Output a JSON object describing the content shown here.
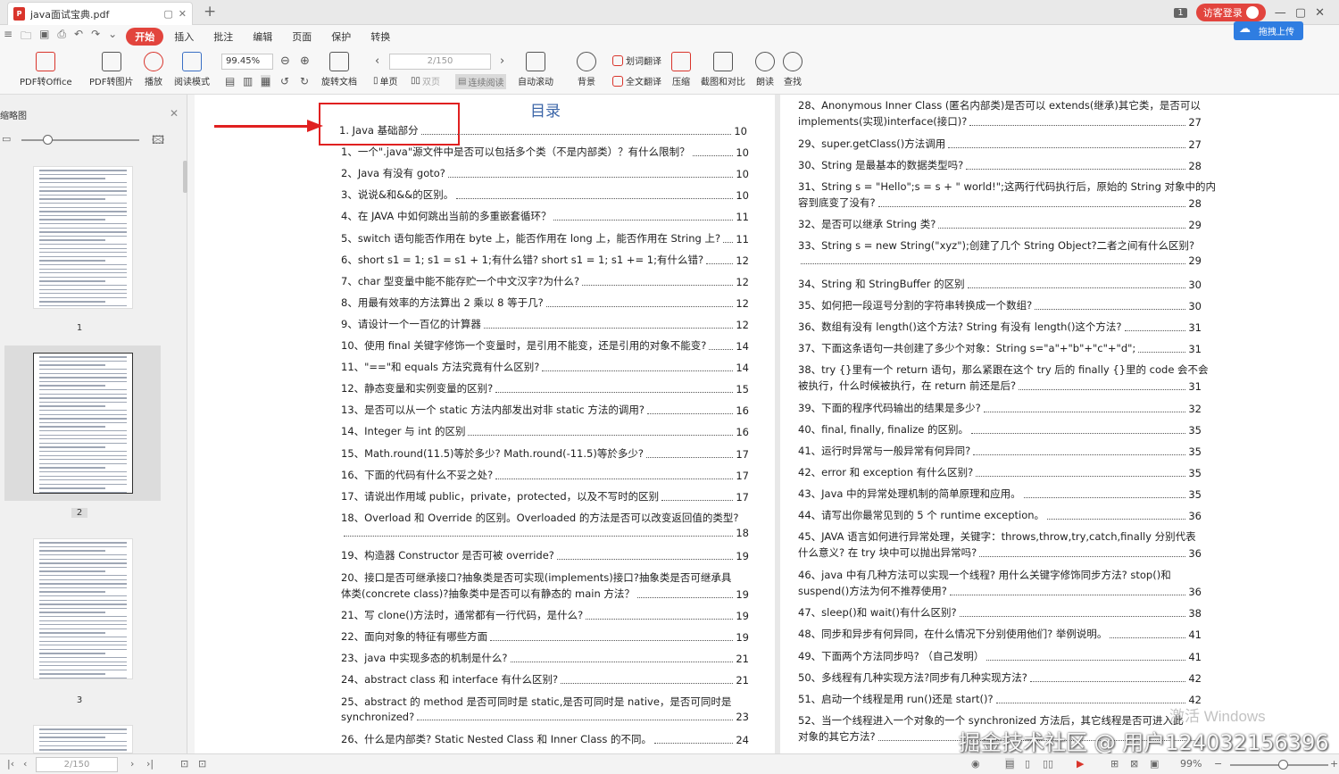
{
  "tab": {
    "title": "java面试宝典.pdf"
  },
  "header": {
    "page_badge": "1",
    "login_label": "访客登录",
    "upload_label": "拖拽上传"
  },
  "menu": [
    "开始",
    "插入",
    "批注",
    "编辑",
    "页面",
    "保护",
    "转换"
  ],
  "toolbar": {
    "pdf_to_office": "PDF转Office",
    "pdf_to_image": "PDF转图片",
    "play": "播放",
    "read_mode": "阅读模式",
    "zoom": "99.45%",
    "rotate": "旋转文档",
    "page_value": "2/150",
    "single": "单页",
    "double": "双页",
    "continuous": "连续阅读",
    "autoscroll": "自动滚动",
    "background": "背景",
    "word_translate": "划词翻译",
    "full_translate": "全文翻译",
    "compress": "压缩",
    "screenshot_compare": "截图和对比",
    "read_aloud": "朗读",
    "find": "查找"
  },
  "sidebar": {
    "title": "缩略图",
    "thumb_labels": [
      "1",
      "2",
      "3"
    ]
  },
  "toc": {
    "title": "目录",
    "left": [
      {
        "text": "1. Java 基础部分",
        "page": "10"
      },
      {
        "text": "1、一个\".java\"源文件中是否可以包括多个类（不是内部类）？有什么限制？",
        "page": "10"
      },
      {
        "text": "2、Java 有没有 goto?",
        "page": "10"
      },
      {
        "text": "3、说说&和&&的区别。",
        "page": "10"
      },
      {
        "text": "4、在 JAVA 中如何跳出当前的多重嵌套循环？",
        "page": "11"
      },
      {
        "text": "5、switch 语句能否作用在 byte 上，能否作用在 long 上，能否作用在 String 上?",
        "page": "11"
      },
      {
        "text": "6、short s1 = 1; s1 = s1 + 1;有什么错? short s1 = 1; s1 += 1;有什么错?",
        "page": "12"
      },
      {
        "text": "7、char 型变量中能不能存贮一个中文汉字?为什么?",
        "page": "12"
      },
      {
        "text": "8、用最有效率的方法算出 2 乘以 8 等于几?",
        "page": "12"
      },
      {
        "text": "9、请设计一个一百亿的计算器",
        "page": "12"
      },
      {
        "text": "10、使用 final 关键字修饰一个变量时，是引用不能变，还是引用的对象不能变?",
        "page": "14"
      },
      {
        "text": "11、\"==\"和 equals 方法究竟有什么区别?",
        "page": "14"
      },
      {
        "text": "12、静态变量和实例变量的区别?",
        "page": "15"
      },
      {
        "text": "13、是否可以从一个 static 方法内部发出对非 static 方法的调用?",
        "page": "16"
      },
      {
        "text": "14、Integer 与 int 的区别",
        "page": "16"
      },
      {
        "text": "15、Math.round(11.5)等於多少? Math.round(-11.5)等於多少?",
        "page": "17"
      },
      {
        "text": "16、下面的代码有什么不妥之处?",
        "page": "17"
      },
      {
        "text": "17、请说出作用域 public，private，protected，以及不写时的区别",
        "page": "17"
      },
      {
        "text": "18、Overload 和 Override 的区别。Overloaded 的方法是否可以改变返回值的类型?",
        "cont": "",
        "page": "18"
      },
      {
        "text": "19、构造器 Constructor 是否可被 override?",
        "page": "19"
      },
      {
        "text": "20、接口是否可继承接口?抽象类是否可实现(implements)接口?抽象类是否可继承具",
        "cont": "体类(concrete class)?抽象类中是否可以有静态的 main 方法？",
        "page": "19"
      },
      {
        "text": "21、写 clone()方法时，通常都有一行代码，是什么?",
        "page": "19"
      },
      {
        "text": "22、面向对象的特征有哪些方面",
        "page": "19"
      },
      {
        "text": "23、java 中实现多态的机制是什么?",
        "page": "21"
      },
      {
        "text": "24、abstract class 和 interface 有什么区别?",
        "page": "21"
      },
      {
        "text": "25、abstract 的 method 是否可同时是 static,是否可同时是 native，是否可同时是",
        "cont": "synchronized?",
        "page": "23"
      },
      {
        "text": "26、什么是内部类? Static Nested Class 和 Inner Class 的不同。",
        "page": "24"
      }
    ],
    "right": [
      {
        "text": "28、Anonymous Inner Class (匿名内部类)是否可以 extends(继承)其它类，是否可以",
        "cont": "implements(实现)interface(接口)?",
        "page": "27"
      },
      {
        "text": "29、super.getClass()方法调用",
        "page": "27"
      },
      {
        "text": "30、String 是最基本的数据类型吗?",
        "page": "28"
      },
      {
        "text": "31、String s = \"Hello\";s = s + \" world!\";这两行代码执行后，原始的 String 对象中的内",
        "cont": "容到底变了没有?",
        "page": "28"
      },
      {
        "text": "32、是否可以继承 String 类?",
        "page": "29"
      },
      {
        "text": "33、String s = new String(\"xyz\");创建了几个 String Object?二者之间有什么区别?",
        "cont": "",
        "page": "29"
      },
      {
        "text": "34、String 和 StringBuffer 的区别",
        "page": "30"
      },
      {
        "text": "35、如何把一段逗号分割的字符串转换成一个数组?",
        "page": "30"
      },
      {
        "text": "36、数组有没有 length()这个方法? String 有没有 length()这个方法?",
        "page": "31"
      },
      {
        "text": "37、下面这条语句一共创建了多少个对象：String s=\"a\"+\"b\"+\"c\"+\"d\";",
        "page": "31"
      },
      {
        "text": "38、try {}里有一个 return 语句，那么紧跟在这个 try 后的 finally {}里的 code 会不会",
        "cont": "被执行，什么时候被执行，在 return 前还是后?",
        "page": "31"
      },
      {
        "text": "39、下面的程序代码输出的结果是多少?",
        "page": "32"
      },
      {
        "text": "40、final, finally, finalize 的区别。",
        "page": "35"
      },
      {
        "text": "41、运行时异常与一般异常有何异同?",
        "page": "35"
      },
      {
        "text": "42、error 和 exception 有什么区别?",
        "page": "35"
      },
      {
        "text": "43、Java 中的异常处理机制的简单原理和应用。",
        "page": "35"
      },
      {
        "text": "44、请写出你最常见到的 5 个 runtime exception。",
        "page": "36"
      },
      {
        "text": "45、JAVA 语言如何进行异常处理，关键字：throws,throw,try,catch,finally 分别代表",
        "cont": "什么意义? 在 try 块中可以抛出异常吗?",
        "page": "36"
      },
      {
        "text": "46、java 中有几种方法可以实现一个线程? 用什么关键字修饰同步方法? stop()和",
        "cont": "suspend()方法为何不推荐使用?",
        "page": "36"
      },
      {
        "text": "47、sleep()和 wait()有什么区别?",
        "page": "38"
      },
      {
        "text": "48、同步和异步有何异同，在什么情况下分别使用他们? 举例说明。",
        "page": "41"
      },
      {
        "text": "49、下面两个方法同步吗? （自己发明）",
        "page": "41"
      },
      {
        "text": "50、多线程有几种实现方法?同步有几种实现方法?",
        "page": "42"
      },
      {
        "text": "51、启动一个线程是用 run()还是 start()?",
        "page": "42"
      },
      {
        "text": "52、当一个线程进入一个对象的一个 synchronized 方法后，其它线程是否可进入此",
        "cont": "对象的其它方法?",
        "page": ""
      }
    ]
  },
  "statusbar": {
    "page_value": "2/150",
    "zoom": "99%"
  },
  "watermark": {
    "windows": "激活 Windows",
    "juejin": "掘金技术社区 @ 用户124032156396"
  }
}
